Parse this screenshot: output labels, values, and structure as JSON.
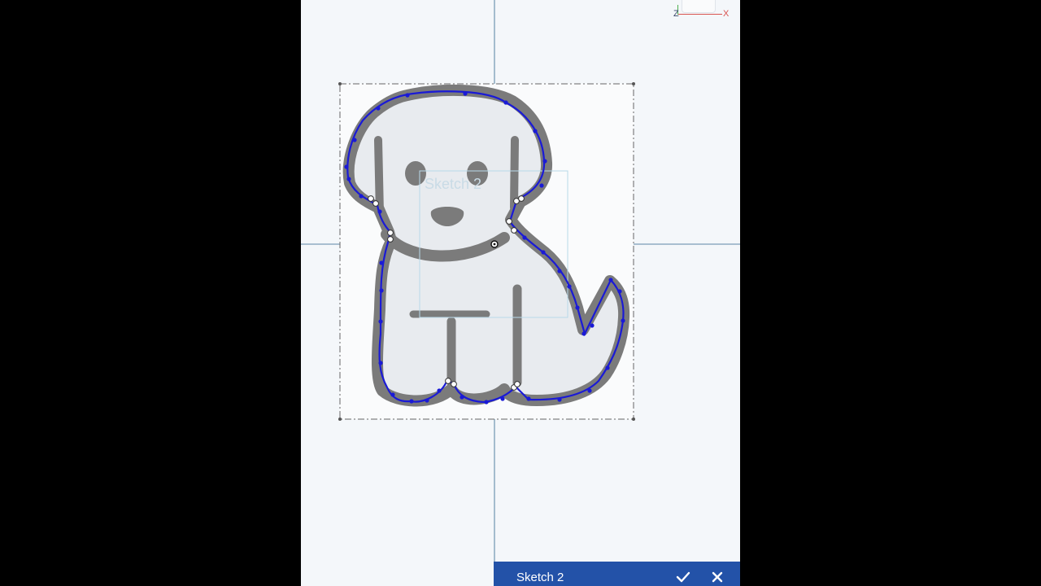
{
  "sketch": {
    "name": "Sketch 2",
    "ghost_label": "Sketch 2"
  },
  "triad": {
    "x_label": "X",
    "z_label": "Z"
  },
  "sketch_bar": {
    "title": "Sketch 2",
    "confirm_icon": "check-icon",
    "cancel_icon": "close-icon"
  },
  "colors": {
    "viewport_bg": "#f4f7fa",
    "outline": "#1a1ad6",
    "fill": "#e8ebef",
    "ink": "#7b7b7b",
    "bar": "#2352a8"
  }
}
